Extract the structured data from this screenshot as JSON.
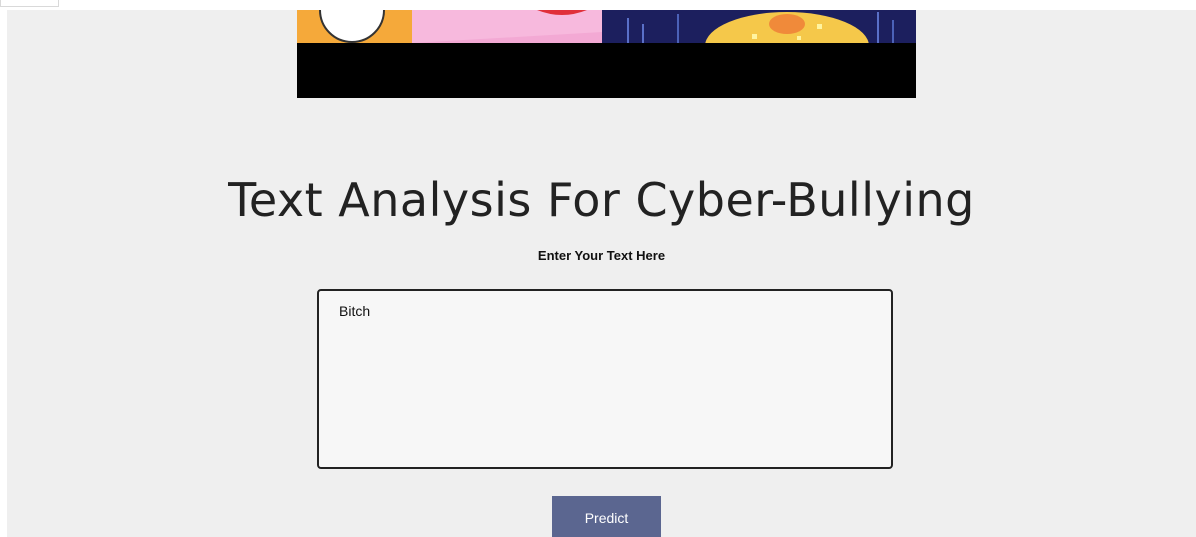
{
  "header": {
    "title": "Text Analysis For Cyber-Bullying",
    "subtitle": "Enter Your Text Here"
  },
  "form": {
    "text_value": "Bitch",
    "predict_label": "Predict"
  },
  "colors": {
    "page_background": "#efefef",
    "button_background": "#5b6690",
    "button_text": "#ffffff"
  }
}
